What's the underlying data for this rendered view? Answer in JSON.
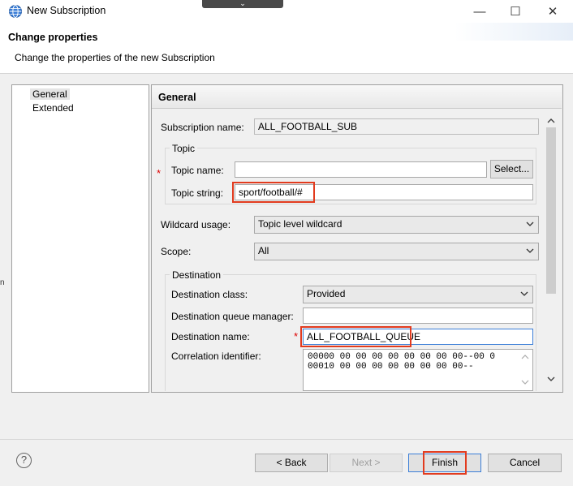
{
  "window": {
    "title": "New Subscription",
    "minimize_glyph": "—",
    "maximize_glyph": "☐",
    "close_glyph": "✕",
    "overlay_glyph": "⌄"
  },
  "header": {
    "title": "Change properties",
    "message": "Change the properties of the new Subscription"
  },
  "nav": {
    "items": [
      {
        "label": "General",
        "selected": true
      },
      {
        "label": "Extended",
        "selected": false
      }
    ]
  },
  "general": {
    "section_title": "General",
    "subscription_name_label": "Subscription name:",
    "subscription_name_value": "ALL_FOOTBALL_SUB",
    "topic_group_label": "Topic",
    "topic_name_label": "Topic name:",
    "topic_name_value": "",
    "select_button": "Select...",
    "topic_string_label": "Topic string:",
    "topic_string_value": "sport/football/#",
    "wildcard_label": "Wildcard usage:",
    "wildcard_value": "Topic level wildcard",
    "scope_label": "Scope:",
    "scope_value": "All",
    "destination_group_label": "Destination",
    "destination_class_label": "Destination class:",
    "destination_class_value": "Provided",
    "destination_qmgr_label": "Destination queue manager:",
    "destination_qmgr_value": "",
    "destination_name_label": "Destination name:",
    "destination_name_value": "ALL_FOOTBALL_QUEUE",
    "correlation_label": "Correlation identifier:",
    "correlation_lines": [
      "00000   00 00 00 00 00 00 00 00--00 0",
      "00010   00 00 00 00 00 00 00 00--"
    ],
    "required_marker": "*"
  },
  "footer": {
    "help_glyph": "?",
    "back_button": "< Back",
    "next_button": "Next >",
    "finish_button": "Finish",
    "cancel_button": "Cancel"
  },
  "misc": {
    "left_edge_mark": "n"
  },
  "colors": {
    "highlight": "#e23b1e",
    "required": "#dd0000"
  }
}
